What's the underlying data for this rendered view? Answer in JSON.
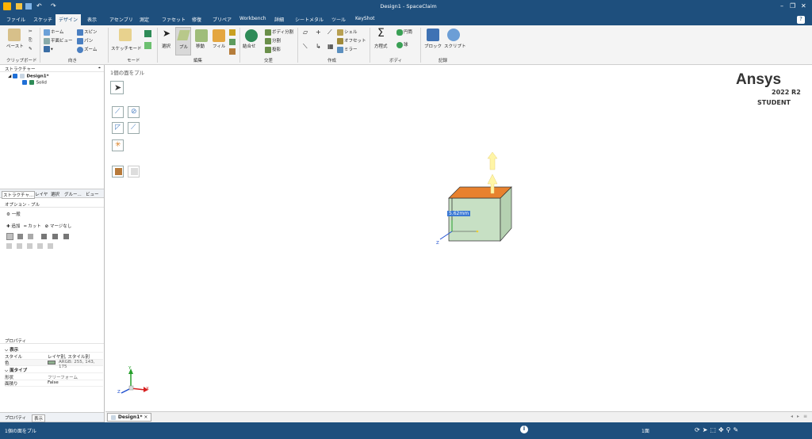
{
  "title": "Design1 - SpaceClaim",
  "window_controls": {
    "minimize": "–",
    "restore": "❐",
    "close": "✕"
  },
  "menu": [
    "ファイル",
    "スケッチ",
    "デザイン",
    "表示",
    "アセンブリ",
    "測定",
    "ファセット",
    "修復",
    "プリペア",
    "Workbench",
    "詳細",
    "シートメタル",
    "ツール",
    "KeyShot"
  ],
  "ribbon": {
    "clipboard": {
      "paste": "ペースト",
      "label": "クリップボード"
    },
    "orient": {
      "home": "ホーム",
      "plan_view": "平面ビュー",
      "spin": "スピン",
      "pan": "パン",
      "zoom": "ズーム",
      "label": "向き"
    },
    "mode": {
      "sketch_mode": "スケッチモード",
      "label": "モード"
    },
    "edit": {
      "select": "選択",
      "pull": "プル",
      "move": "移動",
      "fill": "フィル",
      "label": "編集"
    },
    "intersect": {
      "combine": "結合せ",
      "split_body": "ボディ分割",
      "split": "分割",
      "project": "投影",
      "label": "交差"
    },
    "create": {
      "shell": "シェル",
      "offset": "オフセット",
      "mirror": "ミラー",
      "label": "作成"
    },
    "body": {
      "equation": "方程式",
      "cylinder": "円筒",
      "sphere": "球",
      "label": "ボディ"
    },
    "record": {
      "block": "ブロック",
      "script": "スクリプト",
      "label": "記録"
    }
  },
  "structure": {
    "header": "ストラクチャー",
    "root": "Design1*",
    "child": "Solid"
  },
  "panel_tabs": [
    "ストラクチャ...",
    "レイヤ",
    "選択",
    "グルー...",
    "ビュー"
  ],
  "options": {
    "header": "オプション - プル",
    "general": "一般",
    "add": "追加",
    "cut": "カット",
    "no_merge": "マージなし"
  },
  "properties": {
    "header": "プロパティ",
    "display_section": "表示",
    "style_label": "スタイル",
    "style_value": "レイヤ別, スタイル別",
    "color_label": "色",
    "color_value": "ARGB: 255, 143, 175",
    "face_section": "面タイプ",
    "shape_label": "形状",
    "shape_value": "フリーフォーム",
    "area_label": "面積り",
    "area_value": "False"
  },
  "bottom_tabs": [
    "プロパティ",
    "表示"
  ],
  "viewport": {
    "hint": "1個の面をプル",
    "brand": "Ansys",
    "version": "2022 R2",
    "edition": "STUDENT",
    "dimension": "5.62mm",
    "axis_z": "Z",
    "axis_x": "X",
    "axis_y": "Y"
  },
  "doc_tab": {
    "label": "Design1*",
    "close": "×"
  },
  "status": {
    "message": "1個の面をプル",
    "selection": "1面",
    "info_icon": "i"
  },
  "colors": {
    "accent": "#1e4f7d",
    "box_side": "#c7e0c4",
    "box_top": "#e8812e",
    "arrow": "#fff5a6"
  }
}
